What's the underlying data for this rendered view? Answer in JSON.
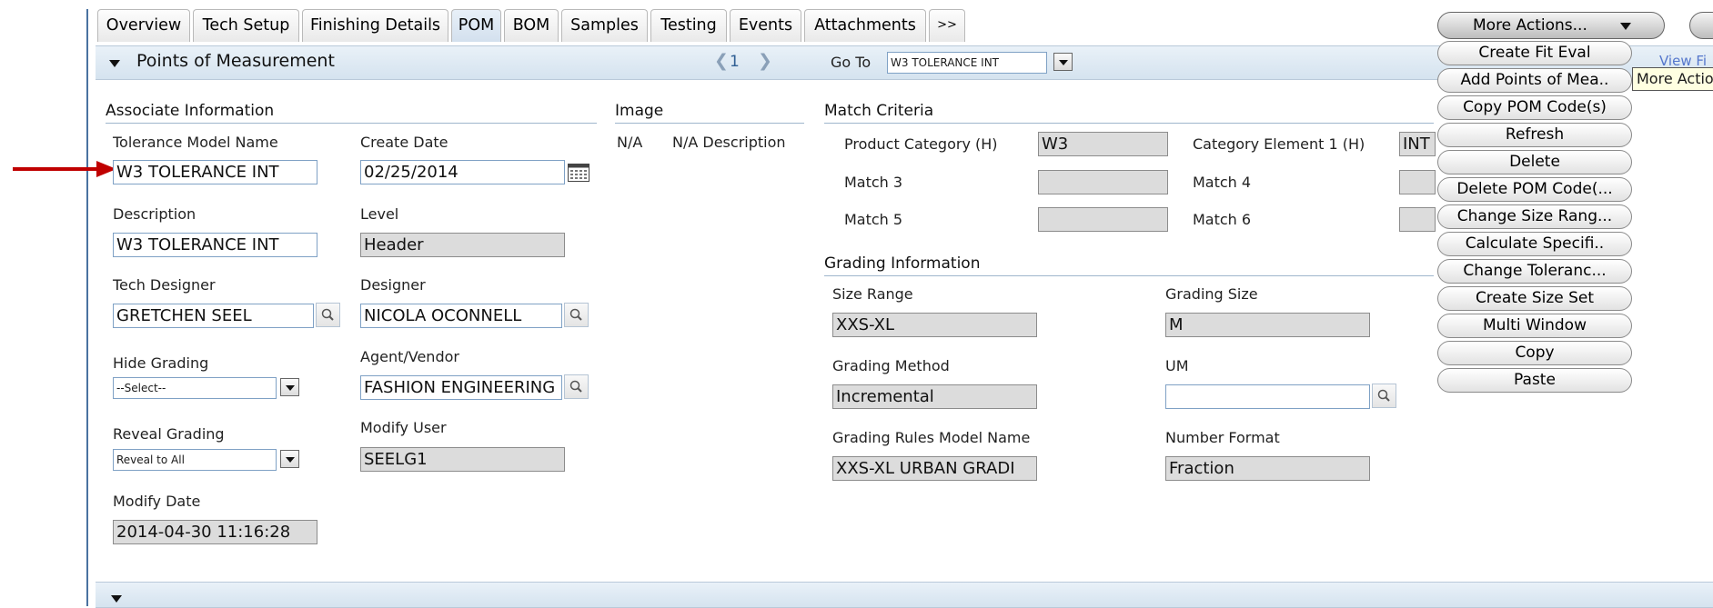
{
  "tabs": [
    {
      "label": "Overview"
    },
    {
      "label": "Tech Setup"
    },
    {
      "label": "Finishing Details"
    },
    {
      "label": "POM"
    },
    {
      "label": "BOM"
    },
    {
      "label": "Samples"
    },
    {
      "label": "Testing"
    },
    {
      "label": "Events"
    },
    {
      "label": "Attachments"
    },
    {
      "label": ">>"
    }
  ],
  "active_tab": "POM",
  "section": {
    "title": "Points of Measurement",
    "page_number": "1",
    "goto_label": "Go To",
    "goto_value": "W3 TOLERANCE INT"
  },
  "more_actions": {
    "label": "More Actions...",
    "tooltip": "More Actions",
    "link_fragment": "View Fi",
    "items": [
      {
        "label": "Create Fit Eval"
      },
      {
        "label": "Add Points of Mea.."
      },
      {
        "label": "Copy POM Code(s)"
      },
      {
        "label": "Refresh"
      },
      {
        "label": "Delete"
      },
      {
        "label": "Delete POM Code(..."
      },
      {
        "label": "Change Size Rang..."
      },
      {
        "label": "Calculate Specifi.."
      },
      {
        "label": "Change Toleranc..."
      },
      {
        "label": "Create Size Set"
      },
      {
        "label": "Multi Window"
      },
      {
        "label": "Copy"
      },
      {
        "label": "Paste"
      }
    ]
  },
  "associate": {
    "heading": "Associate Information",
    "tolerance_model_name": {
      "label": "Tolerance Model Name",
      "value": "W3 TOLERANCE INT"
    },
    "create_date": {
      "label": "Create Date",
      "value": "02/25/2014"
    },
    "description": {
      "label": "Description",
      "value": "W3 TOLERANCE INT"
    },
    "level": {
      "label": "Level",
      "value": "Header"
    },
    "tech_designer": {
      "label": "Tech Designer",
      "value": "GRETCHEN SEEL"
    },
    "designer": {
      "label": "Designer",
      "value": "NICOLA OCONNELL"
    },
    "hide_grading": {
      "label": "Hide Grading",
      "value": "--Select--"
    },
    "agent_vendor": {
      "label": "Agent/Vendor",
      "value": "FASHION ENGINEERING"
    },
    "reveal_grading": {
      "label": "Reveal Grading",
      "value": "Reveal to All"
    },
    "modify_user": {
      "label": "Modify User",
      "value": "SEELG1"
    },
    "modify_date": {
      "label": "Modify Date",
      "value": "2014-04-30 11:16:28"
    }
  },
  "image": {
    "heading": "Image",
    "na": "N/A",
    "na_description": "N/A Description"
  },
  "match": {
    "heading": "Match Criteria",
    "product_category": {
      "label": "Product Category (H)",
      "value": "W3"
    },
    "category_element_1": {
      "label": "Category Element 1 (H)",
      "value": "INT"
    },
    "match3": {
      "label": "Match 3",
      "value": ""
    },
    "match4": {
      "label": "Match 4",
      "value": ""
    },
    "match5": {
      "label": "Match 5",
      "value": ""
    },
    "match6": {
      "label": "Match 6",
      "value": ""
    }
  },
  "grading": {
    "heading": "Grading Information",
    "size_range": {
      "label": "Size Range",
      "value": "XXS-XL"
    },
    "grading_size": {
      "label": "Grading Size",
      "value": "M"
    },
    "grading_method": {
      "label": "Grading Method",
      "value": "Incremental"
    },
    "um": {
      "label": "UM",
      "value": ""
    },
    "rules_model": {
      "label": "Grading Rules Model Name",
      "value": "XXS-XL URBAN GRADI"
    },
    "number_format": {
      "label": "Number Format",
      "value": "Fraction"
    }
  },
  "colors": {
    "arrow": "#c00000",
    "accent": "#4a72a0",
    "bar": "#d5e3ef"
  }
}
